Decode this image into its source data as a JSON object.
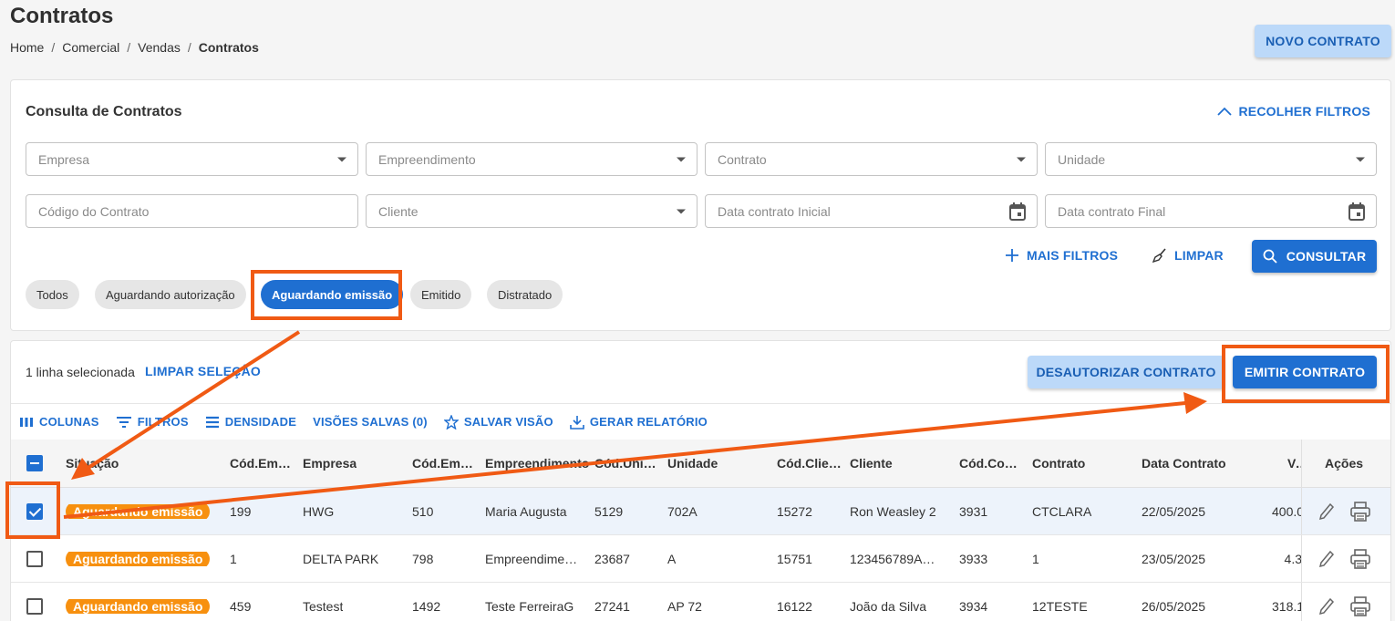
{
  "header": {
    "title": "Contratos",
    "breadcrumb": [
      "Home",
      "Comercial",
      "Vendas",
      "Contratos"
    ],
    "new_button": "NOVO CONTRATO"
  },
  "filters": {
    "title": "Consulta de Contratos",
    "collapse_label": "RECOLHER FILTROS",
    "fields": {
      "empresa": "Empresa",
      "empreendimento": "Empreendimento",
      "contrato": "Contrato",
      "unidade": "Unidade",
      "codigo": "Código do Contrato",
      "cliente": "Cliente",
      "data_inicial": "Data contrato Inicial",
      "data_final": "Data contrato Final"
    },
    "more_label": "MAIS FILTROS",
    "clear_label": "LIMPAR",
    "search_label": "CONSULTAR",
    "chips": [
      "Todos",
      "Aguardando autorização",
      "Aguardando emissão",
      "Emitido",
      "Distratado"
    ],
    "active_chip": "Aguardando emissão"
  },
  "table": {
    "selection_text": "1 linha selecionada",
    "clear_selection": "LIMPAR SELEÇÃO",
    "deauthorize_label": "DESAUTORIZAR CONTRATO",
    "emit_label": "EMITIR CONTRATO",
    "toolbar": {
      "columns": "COLUNAS",
      "filters": "FILTROS",
      "density": "DENSIDADE",
      "saved_views": "VISÕES SALVAS (0)",
      "save_view": "SALVAR VISÃO",
      "report": "GERAR RELATÓRIO"
    },
    "headers": [
      "Situação",
      "Cód.Emp…",
      "Empresa",
      "Cód.Emp…",
      "Empreendimento",
      "Cód.Unid…",
      "Unidade",
      "Cód.Clie…",
      "Cliente",
      "Cód.Cont…",
      "Contrato",
      "Data Contrato",
      "Va",
      "Ações"
    ],
    "rows": [
      {
        "status": "Aguardando emissão",
        "cod_emp": "199",
        "empresa": "HWG",
        "cod_empr": "510",
        "empreendimento": "Maria Augusta",
        "cod_unid": "5129",
        "unidade": "702A",
        "cod_cli": "15272",
        "cliente": "Ron Weasley 2",
        "cod_cont": "3931",
        "contrato": "CTCLARA",
        "data": "22/05/2025",
        "valor": "400.0",
        "selected": true
      },
      {
        "status": "Aguardando emissão",
        "cod_emp": "1",
        "empresa": "DELTA PARK",
        "cod_empr": "798",
        "empreendimento": "Empreendime…",
        "cod_unid": "23687",
        "unidade": "A",
        "cod_cli": "15751",
        "cliente": "123456789A…",
        "cod_cont": "3933",
        "contrato": "1",
        "data": "23/05/2025",
        "valor": "4.3",
        "selected": false
      },
      {
        "status": "Aguardando emissão",
        "cod_emp": "459",
        "empresa": "Testest",
        "cod_empr": "1492",
        "empreendimento": "Teste FerreiraG",
        "cod_unid": "27241",
        "unidade": "AP 72",
        "cod_cli": "16122",
        "cliente": "João da Silva",
        "cod_cont": "3934",
        "contrato": "12TESTE",
        "data": "26/05/2025",
        "valor": "318.1",
        "selected": false
      }
    ]
  },
  "colors": {
    "primary": "#1f6fd1",
    "light_primary": "#bcd9f9",
    "status_orange": "#f7900f",
    "annotation_orange": "#f05a14"
  }
}
